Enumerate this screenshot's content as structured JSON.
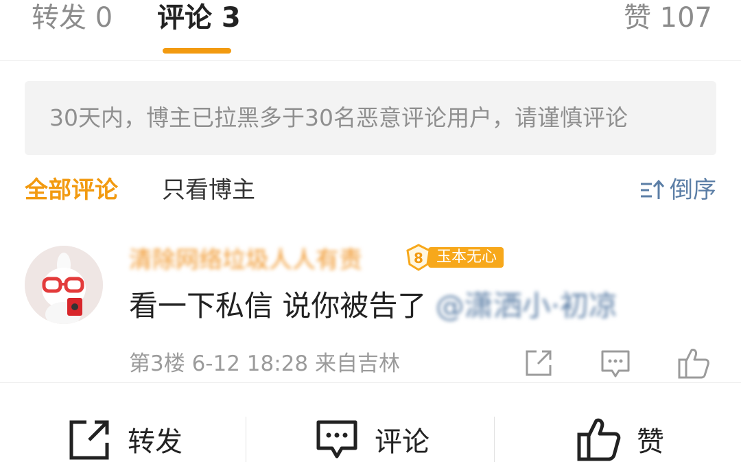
{
  "tabs": [
    {
      "label": "转发 0"
    },
    {
      "label": "评论 3"
    },
    {
      "label": "赞 107"
    }
  ],
  "notice": {
    "text": "30天内，博主已拉黑多于30名恶意评论用户，请谨慎评论"
  },
  "filters": {
    "all_label": "全部评论",
    "author_label": "只看博主",
    "sort_label": "倒序"
  },
  "comment": {
    "username": "清除网络垃圾人人有责",
    "badge_level": "8",
    "badge_text": "玉本无心",
    "text": "看一下私信 说你被告了 ",
    "mention": "@潇洒小·初凉",
    "meta": "第3楼 6-12 18:28 来自吉林",
    "icons": [
      "share-icon",
      "reply-icon",
      "like-icon"
    ]
  },
  "bottom_bar": {
    "repost_label": "转发",
    "comment_label": "评论",
    "like_label": "赞"
  },
  "colors": {
    "accent": "#f29a10",
    "link": "#5b7ea6",
    "username": "#f0962a",
    "badge": "#f7a81b"
  }
}
